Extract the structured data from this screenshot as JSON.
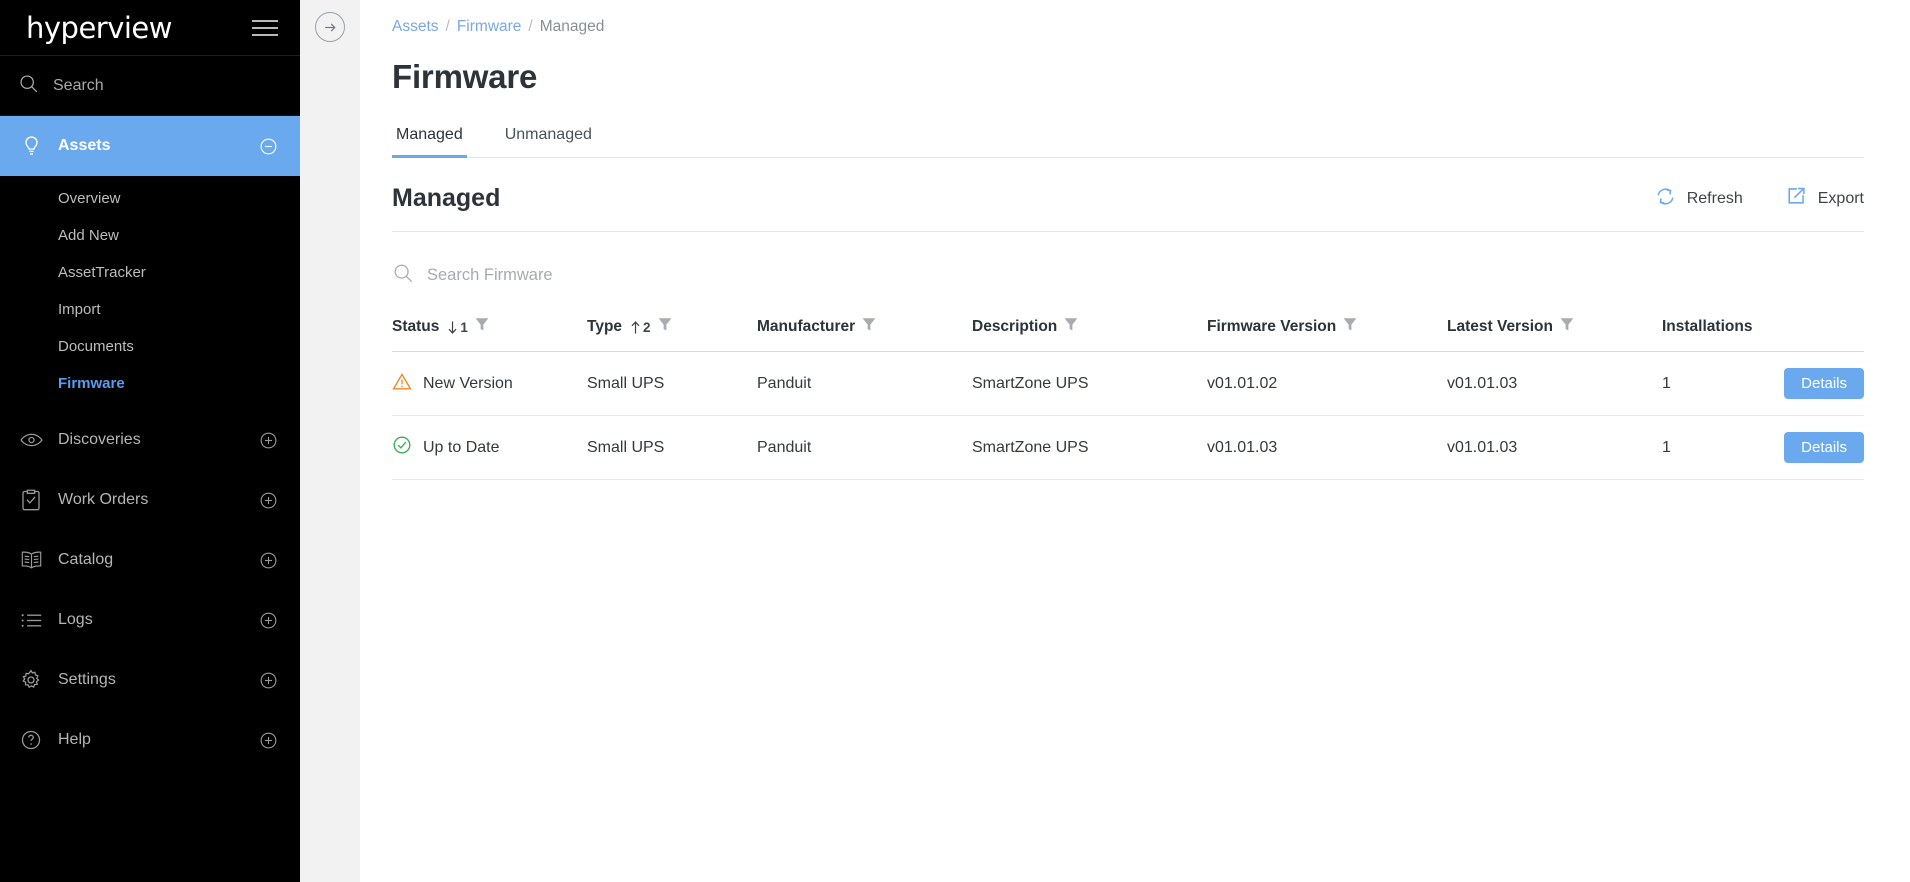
{
  "brand": {
    "name": "hyperview",
    "menu_icon": "hamburger-icon"
  },
  "sidebar": {
    "search": {
      "label": "Search",
      "icon": "search-icon"
    },
    "items": [
      {
        "label": "Assets",
        "icon": "lightbulb-icon",
        "expander": "minus-circle-icon",
        "active": true,
        "children": [
          {
            "label": "Overview",
            "active": false
          },
          {
            "label": "Add New",
            "active": false
          },
          {
            "label": "AssetTracker",
            "active": false
          },
          {
            "label": "Import",
            "active": false
          },
          {
            "label": "Documents",
            "active": false
          },
          {
            "label": "Firmware",
            "active": true
          }
        ]
      },
      {
        "label": "Discoveries",
        "icon": "eye-icon",
        "expander": "plus-circle-icon",
        "active": false,
        "children": []
      },
      {
        "label": "Work Orders",
        "icon": "clipboard-check-icon",
        "expander": "plus-circle-icon",
        "active": false,
        "children": []
      },
      {
        "label": "Catalog",
        "icon": "book-icon",
        "expander": "plus-circle-icon",
        "active": false,
        "children": []
      },
      {
        "label": "Logs",
        "icon": "list-icon",
        "expander": "plus-circle-icon",
        "active": false,
        "children": []
      },
      {
        "label": "Settings",
        "icon": "gear-icon",
        "expander": "plus-circle-icon",
        "active": false,
        "children": []
      },
      {
        "label": "Help",
        "icon": "question-circle-icon",
        "expander": "plus-circle-icon",
        "active": false,
        "children": []
      }
    ]
  },
  "gutter": {
    "collapse_icon": "arrow-right-circle-icon"
  },
  "breadcrumb": {
    "root": "Assets",
    "sep1": "/",
    "mid": "Firmware",
    "sep2": "/",
    "current": "Managed"
  },
  "page": {
    "title": "Firmware"
  },
  "tabs": [
    {
      "label": "Managed",
      "active": true
    },
    {
      "label": "Unmanaged",
      "active": false
    }
  ],
  "section": {
    "title": "Managed",
    "refresh_label": "Refresh",
    "refresh_icon": "refresh-icon",
    "export_label": "Export",
    "export_icon": "export-icon"
  },
  "search": {
    "placeholder": "Search Firmware",
    "value": "",
    "icon": "search-icon"
  },
  "table": {
    "columns": [
      {
        "label": "Status",
        "sort": "desc",
        "sort_order": "1",
        "filter": true
      },
      {
        "label": "Type",
        "sort": "asc",
        "sort_order": "2",
        "filter": true
      },
      {
        "label": "Manufacturer",
        "sort": null,
        "sort_order": "",
        "filter": true
      },
      {
        "label": "Description",
        "sort": null,
        "sort_order": "",
        "filter": true
      },
      {
        "label": "Firmware Version",
        "sort": null,
        "sort_order": "",
        "filter": true
      },
      {
        "label": "Latest Version",
        "sort": null,
        "sort_order": "",
        "filter": true
      },
      {
        "label": "Installations",
        "sort": null,
        "sort_order": "",
        "filter": false
      }
    ],
    "rows": [
      {
        "status": "New Version",
        "status_icon": "warning-triangle-icon",
        "status_color": "#ef8722",
        "type": "Small UPS",
        "manufacturer": "Panduit",
        "description": "SmartZone UPS",
        "firmware_version": "v01.01.02",
        "latest_version": "v01.01.03",
        "installations": "1",
        "action_label": "Details"
      },
      {
        "status": "Up to Date",
        "status_icon": "check-circle-icon",
        "status_color": "#3fae5a",
        "type": "Small UPS",
        "manufacturer": "Panduit",
        "description": "SmartZone UPS",
        "firmware_version": "v01.01.03",
        "latest_version": "v01.01.03",
        "installations": "1",
        "action_label": "Details"
      }
    ]
  },
  "colors": {
    "accent": "#6aa9ee",
    "sidebar_bg": "#000000",
    "gutter_bg": "#f2f2f2",
    "link": "#7aa7e8",
    "warning": "#ef8722",
    "ok": "#3fae5a"
  }
}
